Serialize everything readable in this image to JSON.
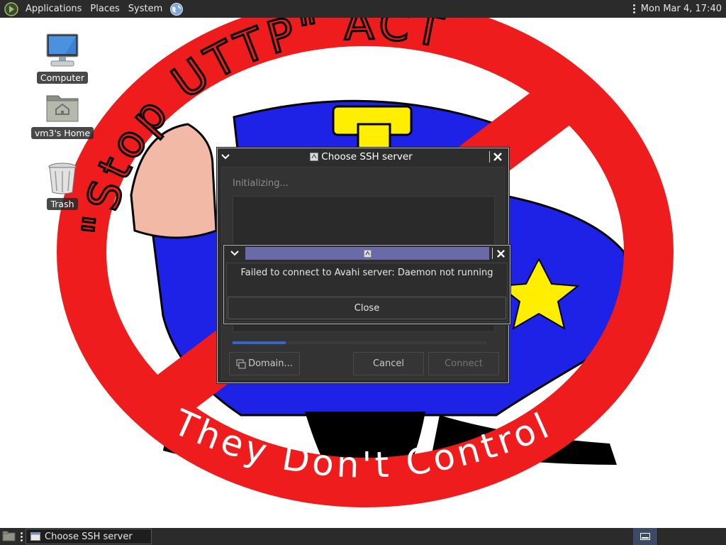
{
  "top_panel": {
    "menus": [
      "Applications",
      "Places",
      "System"
    ],
    "clock": "Mon Mar  4, 17:40",
    "icons": [
      "gnome-foot-icon",
      "network-globe-icon",
      "panel-menu-icon"
    ]
  },
  "desktop": {
    "icons": [
      {
        "label": "Computer",
        "icon": "computer-icon"
      },
      {
        "label": "vm3's Home",
        "icon": "home-folder-icon"
      },
      {
        "label": "Trash",
        "icon": "trash-icon"
      }
    ],
    "wallpaper": {
      "arc_top_text": "\"Stop UTTP\" ACT",
      "arc_bottom_text": "They Don't Control",
      "colors": {
        "ring": "#ee1c1c",
        "uniform": "#1e22e6",
        "skin": "#f2b9a6",
        "badge": "#ffee00"
      }
    }
  },
  "ssh_dialog": {
    "title": "Choose SSH server",
    "status": "Initializing...",
    "buttons": {
      "domain": "Domain...",
      "cancel": "Cancel",
      "connect": "Connect"
    }
  },
  "error_dialog": {
    "message": "Failed to connect to Avahi server: Daemon not running",
    "close_label": "Close"
  },
  "taskbar": {
    "items": [
      {
        "label": "Choose SSH server",
        "icon": "window-icon"
      }
    ],
    "icons": [
      "show-desktop-icon",
      "workspace-switcher-icon"
    ]
  },
  "colors": {
    "panel": "#2b2b2b",
    "dialog_bg": "#2d2d2d",
    "error_title_accent": "#6b6aa8"
  }
}
